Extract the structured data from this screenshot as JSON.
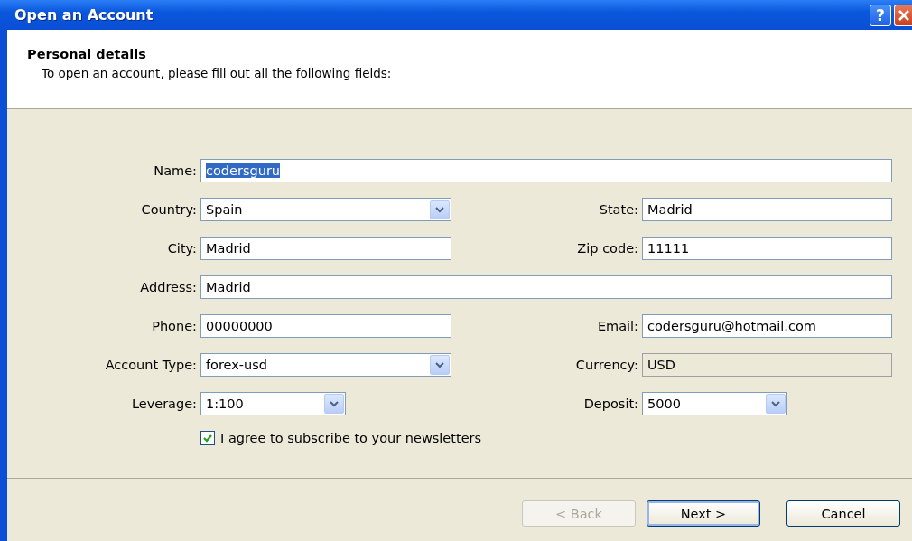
{
  "window": {
    "title": "Open an Account",
    "help_button": "?"
  },
  "header": {
    "title": "Personal details",
    "subtitle": "To open an account, please fill out all the following fields:"
  },
  "rows": [
    [
      {
        "label": "Name:",
        "value": "codersguru",
        "kind": "text",
        "text_selected": true
      }
    ],
    [
      {
        "label": "Country:",
        "value": "Spain",
        "kind": "dropdown",
        "text_selected": false
      },
      {
        "label": "State:",
        "value": "Madrid",
        "kind": "text",
        "text_selected": false
      }
    ],
    [
      {
        "label": "City:",
        "value": "Madrid",
        "kind": "text",
        "text_selected": false
      },
      {
        "label": "Zip code:",
        "value": "11111",
        "kind": "text",
        "text_selected": false
      }
    ],
    [
      {
        "label": "Address:",
        "value": "Madrid",
        "kind": "text",
        "text_selected": false
      }
    ],
    [
      {
        "label": "Phone:",
        "value": "00000000",
        "kind": "text",
        "text_selected": false
      },
      {
        "label": "Email:",
        "value": "codersguru@hotmail.com",
        "kind": "text",
        "text_selected": false
      }
    ],
    [
      {
        "label": "Account Type:",
        "value": "forex-usd",
        "kind": "dropdown",
        "text_selected": false
      },
      {
        "label": "Currency:",
        "value": "USD",
        "kind": "readonly",
        "text_selected": false
      }
    ],
    [
      {
        "label": "Leverage:",
        "value": "1:100",
        "kind": "small-dropdown",
        "text_selected": false
      },
      {
        "label": "Deposit:",
        "value": "5000",
        "kind": "small-dropdown",
        "text_selected": false
      }
    ]
  ],
  "newsletter": {
    "label": "I agree to subscribe to your newsletters",
    "checked": true
  },
  "buttons": [
    {
      "label": "< Back",
      "disabled": true,
      "default": false
    },
    {
      "label": "Next >",
      "disabled": false,
      "default": true
    },
    {
      "label": "Cancel",
      "disabled": false,
      "default": false
    }
  ]
}
